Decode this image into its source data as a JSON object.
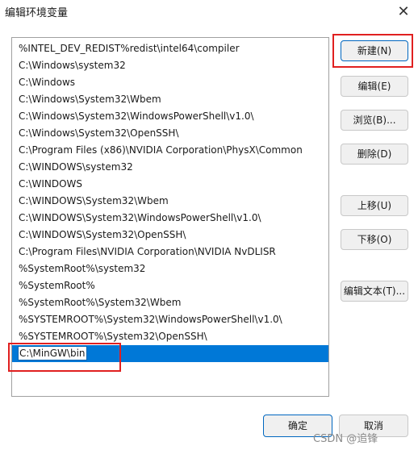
{
  "window": {
    "title": "编辑环境变量",
    "close_icon": "close-icon"
  },
  "path_list": {
    "items": [
      "%INTEL_DEV_REDIST%redist\\intel64\\compiler",
      "C:\\Windows\\system32",
      "C:\\Windows",
      "C:\\Windows\\System32\\Wbem",
      "C:\\Windows\\System32\\WindowsPowerShell\\v1.0\\",
      "C:\\Windows\\System32\\OpenSSH\\",
      "C:\\Program Files (x86)\\NVIDIA Corporation\\PhysX\\Common",
      "C:\\WINDOWS\\system32",
      "C:\\WINDOWS",
      "C:\\WINDOWS\\System32\\Wbem",
      "C:\\WINDOWS\\System32\\WindowsPowerShell\\v1.0\\",
      "C:\\WINDOWS\\System32\\OpenSSH\\",
      "C:\\Program Files\\NVIDIA Corporation\\NVIDIA NvDLISR",
      "%SystemRoot%\\system32",
      "%SystemRoot%",
      "%SystemRoot%\\System32\\Wbem",
      "%SYSTEMROOT%\\System32\\WindowsPowerShell\\v1.0\\",
      "%SYSTEMROOT%\\System32\\OpenSSH\\"
    ],
    "editing_value": "C:\\MinGW\\bin"
  },
  "buttons": {
    "new": "新建(N)",
    "edit": "编辑(E)",
    "browse": "浏览(B)...",
    "delete": "删除(D)",
    "move_up": "上移(U)",
    "move_down": "下移(O)",
    "edit_text": "编辑文本(T)...",
    "ok": "确定",
    "cancel": "取消"
  },
  "watermark": "CSDN @追锋",
  "colors": {
    "selection": "#0078d7",
    "highlight": "#e02020"
  }
}
